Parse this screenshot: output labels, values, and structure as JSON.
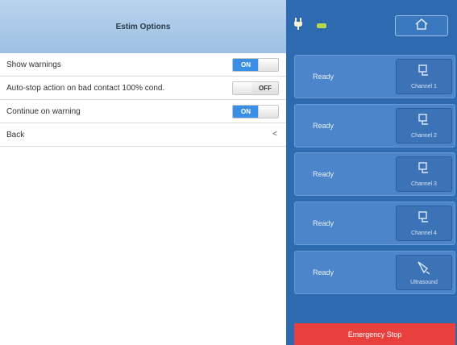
{
  "header": {
    "title": "Estim Options"
  },
  "options": [
    {
      "label": "Show warnings",
      "toggle": "ON"
    },
    {
      "label": "Auto-stop action on bad contact 100% cond.",
      "toggle": "OFF"
    },
    {
      "label": "Continue on warning",
      "toggle": "ON"
    }
  ],
  "back": {
    "label": "Back",
    "arrow": "<"
  },
  "device": {
    "plug_icon": "plug-icon",
    "battery_icon": "battery-icon",
    "home_icon": "home-icon"
  },
  "channels": [
    {
      "status": "Ready",
      "name": "Channel 1",
      "icon": "electrode-icon"
    },
    {
      "status": "Ready",
      "name": "Channel 2",
      "icon": "electrode-icon"
    },
    {
      "status": "Ready",
      "name": "Channel 3",
      "icon": "electrode-icon"
    },
    {
      "status": "Ready",
      "name": "Channel 4",
      "icon": "electrode-icon"
    },
    {
      "status": "Ready",
      "name": "Ultrasound",
      "icon": "ultrasound-probe-icon"
    }
  ],
  "emergency": {
    "label": "Emergency Stop"
  },
  "colors": {
    "accent": "#3a8ee6",
    "panel": "#2e6ab0",
    "emergency": "#e8403d"
  }
}
